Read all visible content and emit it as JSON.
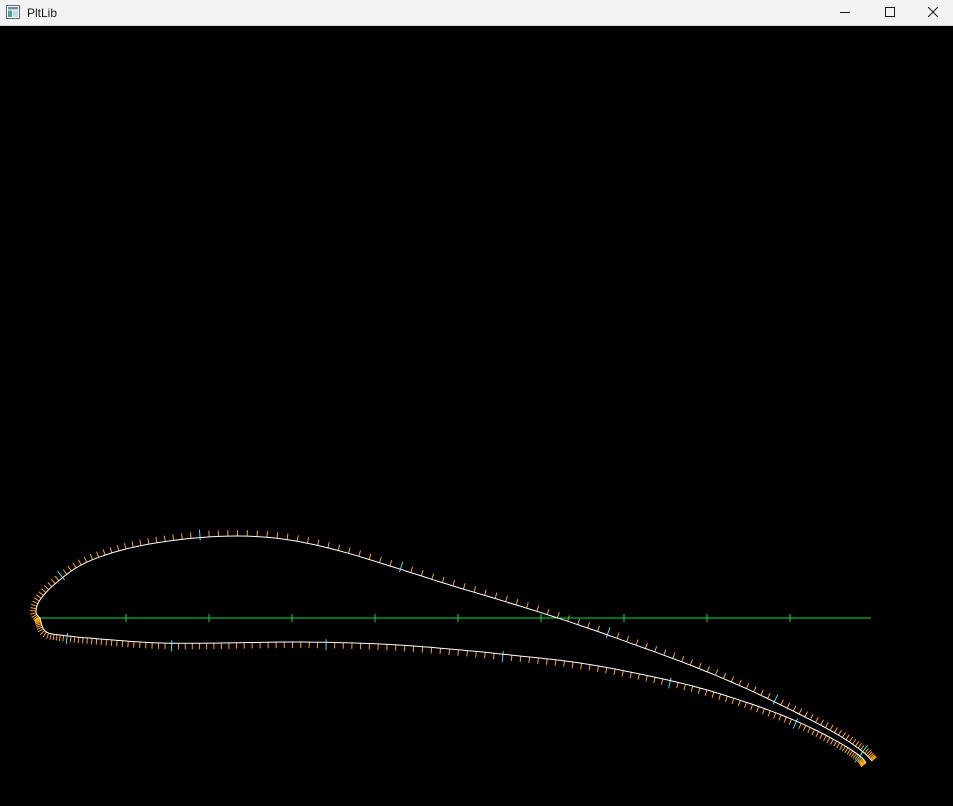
{
  "window": {
    "title": "PltLib",
    "icon": "app-window-icon",
    "controls": {
      "minimize": "minimize-icon",
      "maximize": "maximize-icon",
      "close": "close-icon"
    }
  },
  "plot": {
    "background": "#000000",
    "colors": {
      "airfoil_outline": "#ffffff",
      "panel_ticks": "#ffa500",
      "major_ticks": "#40e0e8",
      "chord_line": "#00e040"
    },
    "shape": "cambered airfoil with surface panel normals and chord line"
  }
}
